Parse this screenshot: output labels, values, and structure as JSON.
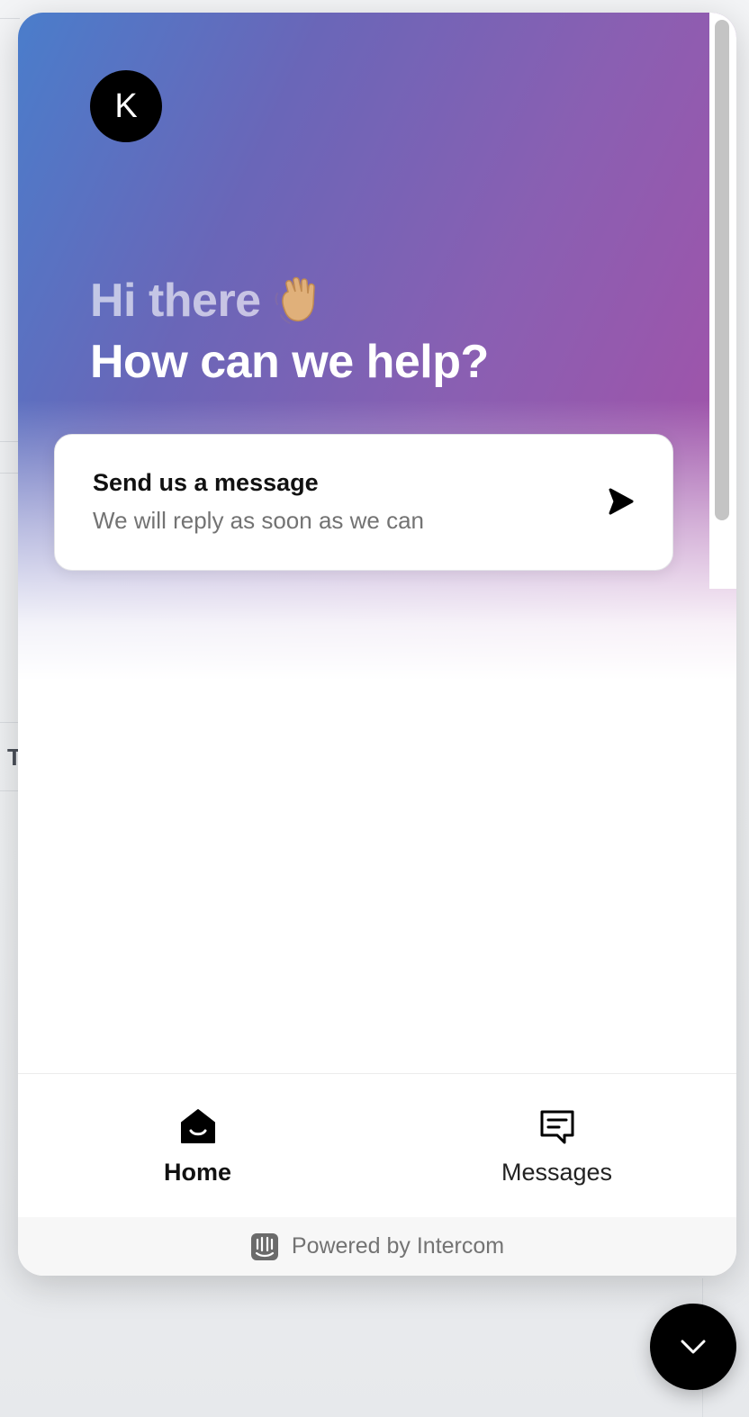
{
  "avatar": {
    "initial": "K"
  },
  "hero": {
    "greeting": "Hi there",
    "headline": "How can we help?"
  },
  "message_card": {
    "title": "Send us a message",
    "subtitle": "We will reply as soon as we can",
    "icon": "send-arrow-icon"
  },
  "nav": {
    "items": [
      {
        "label": "Home",
        "icon": "home-icon",
        "active": true
      },
      {
        "label": "Messages",
        "icon": "messages-icon",
        "active": false
      }
    ]
  },
  "footer": {
    "text": "Powered by Intercom",
    "icon": "intercom-logo-icon"
  },
  "launcher": {
    "icon": "chevron-down-icon"
  },
  "background": {
    "partial_letter": "T"
  },
  "colors": {
    "gradient_start": "#4a7dcb",
    "gradient_end": "#a94fa6",
    "accent": "#000000"
  }
}
